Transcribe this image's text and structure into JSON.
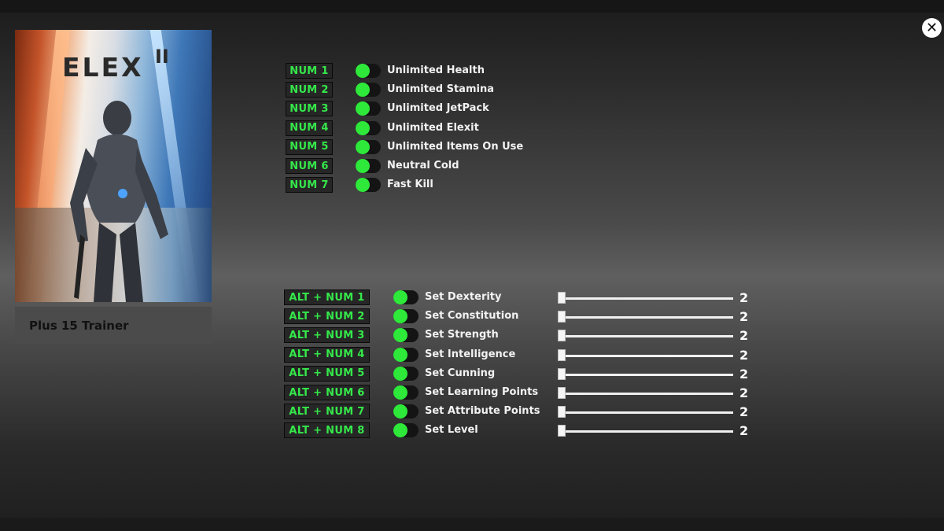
{
  "game": {
    "logo_text": "ELEX",
    "logo_sup": "II",
    "trainer_label": "Plus 15 Trainer"
  },
  "close_label": "✕",
  "toggles": [
    {
      "key": "NUM 1",
      "label": "Unlimited Health"
    },
    {
      "key": "NUM 2",
      "label": "Unlimited Stamina"
    },
    {
      "key": "NUM 3",
      "label": "Unlimited JetPack"
    },
    {
      "key": "NUM 4",
      "label": "Unlimited Elexit"
    },
    {
      "key": "NUM 5",
      "label": "Unlimited Items On Use"
    },
    {
      "key": "NUM 6",
      "label": "Neutral Cold"
    },
    {
      "key": "NUM 7",
      "label": "Fast Kill"
    }
  ],
  "setters": [
    {
      "key": "ALT + NUM 1",
      "label": "Set Dexterity",
      "value": "2"
    },
    {
      "key": "ALT + NUM 2",
      "label": "Set Constitution",
      "value": "2"
    },
    {
      "key": "ALT + NUM 3",
      "label": "Set Strength",
      "value": "2"
    },
    {
      "key": "ALT + NUM 4",
      "label": "Set Intelligence",
      "value": "2"
    },
    {
      "key": "ALT + NUM 5",
      "label": "Set Cunning",
      "value": "2"
    },
    {
      "key": "ALT + NUM 6",
      "label": "Set Learning Points",
      "value": "2"
    },
    {
      "key": "ALT + NUM 7",
      "label": "Set Attribute Points",
      "value": "2"
    },
    {
      "key": "ALT + NUM 8",
      "label": "Set Level",
      "value": "2"
    }
  ],
  "colors": {
    "key_text": "#35e84a",
    "toggle_knob": "#2ee83a"
  }
}
